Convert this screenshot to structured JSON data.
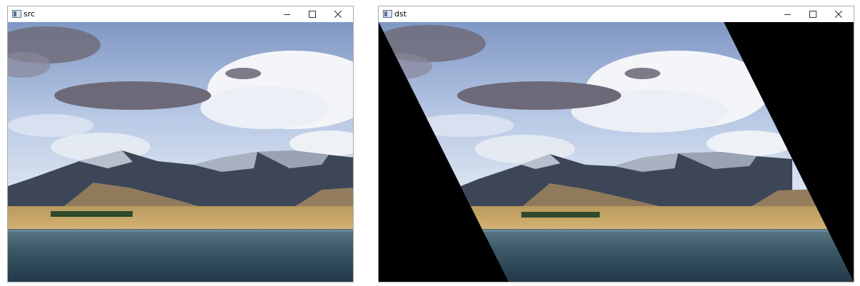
{
  "windows": [
    {
      "title": "src",
      "controls": {
        "minimize": "–",
        "maximize": "☐",
        "close": "✕"
      }
    },
    {
      "title": "dst",
      "controls": {
        "minimize": "–",
        "maximize": "☐",
        "close": "✕"
      }
    }
  ],
  "colors": {
    "sky_top": "#7f97c4",
    "sky_mid": "#c4d3ea",
    "cloud_white": "#f4f5f8",
    "cloud_grey": "#6e6c7a",
    "mountain_dark": "#3c4657",
    "mountain_snow": "#b8bfcc",
    "hill_brown": "#8f7a5c",
    "plain_gold": "#c8a765",
    "water_top": "#4f6f7f",
    "water_deep": "#263f4c",
    "fill_black": "#000000"
  }
}
